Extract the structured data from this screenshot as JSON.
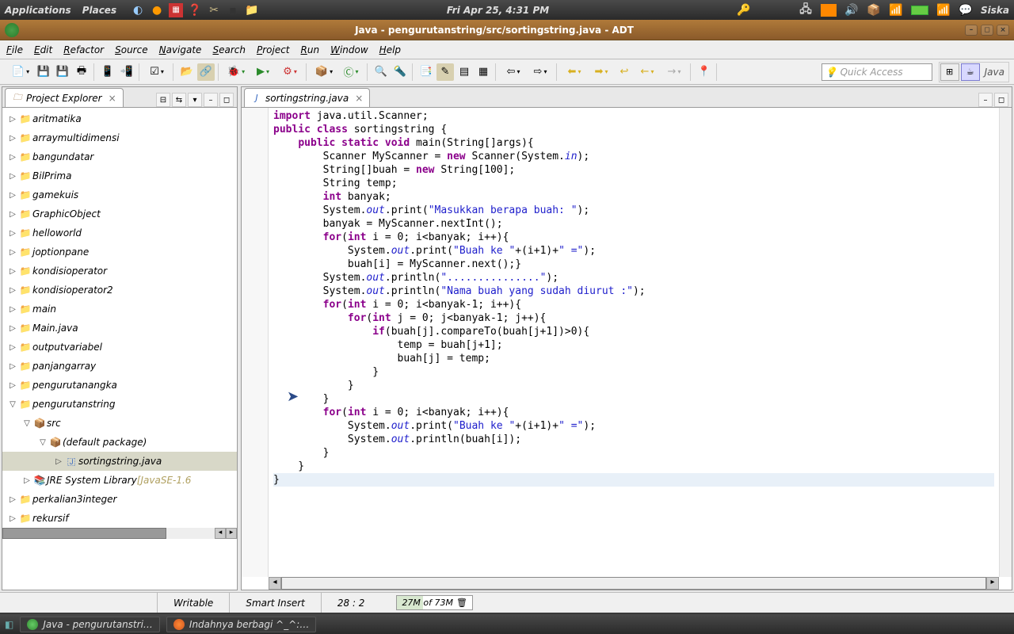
{
  "gnome": {
    "applications": "Applications",
    "places": "Places",
    "clock": "Fri Apr 25,  4:31 PM",
    "user": "Siska"
  },
  "window": {
    "title": "Java - pengurutanstring/src/sortingstring.java - ADT"
  },
  "menubar": [
    "File",
    "Edit",
    "Refactor",
    "Source",
    "Navigate",
    "Search",
    "Project",
    "Run",
    "Window",
    "Help"
  ],
  "quick_access_placeholder": "Quick Access",
  "java_persp": "Java",
  "project_explorer": {
    "title": "Project Explorer",
    "items": [
      {
        "label": "aritmatika",
        "lvl": 0,
        "exp": false,
        "icon": "folder"
      },
      {
        "label": "arraymultidimensi",
        "lvl": 0,
        "exp": false,
        "icon": "folder"
      },
      {
        "label": "bangundatar",
        "lvl": 0,
        "exp": false,
        "icon": "folder"
      },
      {
        "label": "BilPrima",
        "lvl": 0,
        "exp": false,
        "icon": "folder"
      },
      {
        "label": "gamekuis",
        "lvl": 0,
        "exp": false,
        "icon": "folder"
      },
      {
        "label": "GraphicObject",
        "lvl": 0,
        "exp": false,
        "icon": "folder"
      },
      {
        "label": "helloworld",
        "lvl": 0,
        "exp": false,
        "icon": "folder"
      },
      {
        "label": "joptionpane",
        "lvl": 0,
        "exp": false,
        "icon": "folder"
      },
      {
        "label": "kondisioperator",
        "lvl": 0,
        "exp": false,
        "icon": "folder"
      },
      {
        "label": "kondisioperator2",
        "lvl": 0,
        "exp": false,
        "icon": "folder"
      },
      {
        "label": "main",
        "lvl": 0,
        "exp": false,
        "icon": "folder"
      },
      {
        "label": "Main.java",
        "lvl": 0,
        "exp": false,
        "icon": "folder"
      },
      {
        "label": "outputvariabel",
        "lvl": 0,
        "exp": false,
        "icon": "folder"
      },
      {
        "label": "panjangarray",
        "lvl": 0,
        "exp": false,
        "icon": "folder"
      },
      {
        "label": "pengurutanangka",
        "lvl": 0,
        "exp": false,
        "icon": "folder"
      },
      {
        "label": "pengurutanstring",
        "lvl": 0,
        "exp": true,
        "icon": "folder"
      },
      {
        "label": "src",
        "lvl": 1,
        "exp": true,
        "icon": "pkg"
      },
      {
        "label": "(default package)",
        "lvl": 2,
        "exp": true,
        "icon": "pkg"
      },
      {
        "label": "sortingstring.java",
        "lvl": 3,
        "exp": false,
        "icon": "jfile",
        "sel": true
      },
      {
        "label": "JRE System Library",
        "tag": "[JavaSE-1.6",
        "lvl": 1,
        "exp": false,
        "icon": "lib"
      },
      {
        "label": "perkalian3integer",
        "lvl": 0,
        "exp": false,
        "icon": "folder"
      },
      {
        "label": "rekursif",
        "lvl": 0,
        "exp": false,
        "icon": "folder"
      }
    ]
  },
  "editor": {
    "tab": "sortingstring.java"
  },
  "status": {
    "writable": "Writable",
    "insert": "Smart Insert",
    "pos": "28 : 2",
    "mem": "27M of 73M"
  },
  "taskbar": {
    "t1": "Java - pengurutanstri…",
    "t2": "Indahnya berbagi ^_^:…"
  }
}
